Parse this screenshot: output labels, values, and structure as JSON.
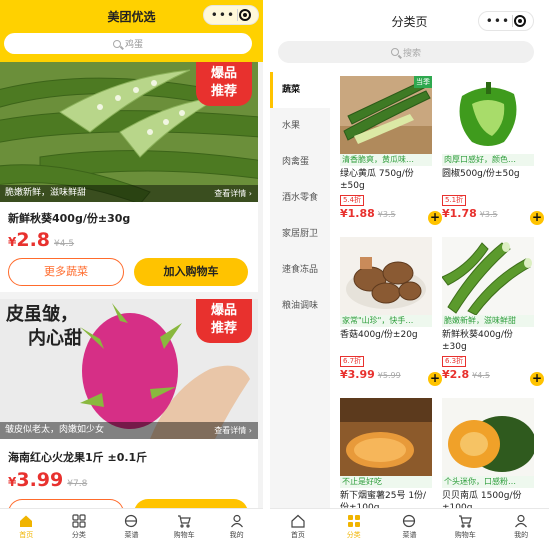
{
  "home": {
    "title": "美团优选",
    "search_placeholder": "鸡蛋",
    "products": [
      {
        "badge": "爆品\n推荐",
        "caption": "脆嫩新鲜，滋味鲜甜",
        "detail": "查看详情 ›",
        "name": "新鲜秋葵400g/份±30g",
        "currency": "¥",
        "price": "2.8",
        "old_price": "¥4.5",
        "more_label": "更多蔬菜",
        "cart_label": "加入购物车"
      },
      {
        "badge": "爆品\n推荐",
        "caption": "皱皮似老太，肉嫩如少女",
        "detail": "查看详情 ›",
        "name": "海南红心火龙果1斤 ±0.1斤",
        "currency": "¥",
        "price": "3.99",
        "old_price": "¥7.8",
        "image_text": "皮虽皱，\n内心甜"
      }
    ]
  },
  "category": {
    "title": "分类页",
    "search_placeholder": "搜索",
    "sidebar": [
      "蔬菜",
      "水果",
      "肉禽蛋",
      "酒水零食",
      "家居厨卫",
      "速食冻品",
      "粮油调味"
    ],
    "products": [
      {
        "tag": "当季",
        "desc": "清香脆爽，黄瓜味…",
        "name": "绿心黄瓜 750g/份±50g",
        "discount": "5.4折",
        "price": "¥1.88",
        "old_price": "¥3.5"
      },
      {
        "desc": "肉厚口感好，颜色…",
        "name": "圆椒500g/份±50g",
        "discount": "5.1折",
        "price": "¥1.78",
        "old_price": "¥3.5"
      },
      {
        "desc": "家常\"山珍\"，快手…",
        "name": "香菇400g/份±20g",
        "discount": "6.7折",
        "price": "¥3.99",
        "old_price": "¥5.99"
      },
      {
        "desc": "脆嫩新鲜，滋味鲜甜",
        "name": "新鲜秋葵400g/份±30g",
        "discount": "6.3折",
        "price": "¥2.8",
        "old_price": "¥4.5"
      },
      {
        "desc": "不止是好吃",
        "name": "新下烟蜜薯25号 1份/份±100g",
        "discount": "",
        "price": "",
        "old_price": ""
      },
      {
        "desc": "个头迷你，口感粉…",
        "name": "贝贝南瓜 1500g/份±100g",
        "discount": "",
        "price": "",
        "old_price": ""
      }
    ]
  },
  "tabbar": [
    "首页",
    "分类",
    "菜谱",
    "购物车",
    "我的"
  ],
  "colors": {
    "brand_yellow": "#ffd100",
    "price_red": "#e8312e",
    "accent_orange": "#ff6b2c",
    "fresh_green": "#2f9e3c"
  }
}
